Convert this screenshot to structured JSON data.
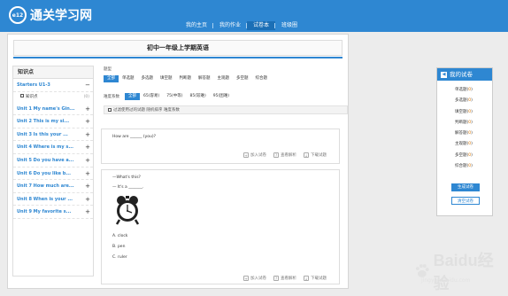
{
  "header": {
    "logo_badge": "e12",
    "logo_text": "通关学习网",
    "nav": [
      "我的主页",
      "我的作业",
      "试卷本",
      "班级圈"
    ],
    "active_nav": "试卷本",
    "brand_color": "#2e87d2"
  },
  "page_title": "初中一年级上学期英语",
  "sidebar": {
    "title": "知识点",
    "group": "Starters U1-3",
    "group_toggle": "−",
    "sub_item": "知识点",
    "sub_count": "(0)",
    "units": [
      "Unit 1 My name's Gin...",
      "Unit 2 This is my si...",
      "Unit 3 Is this your ...",
      "Unit 4 Where is my s...",
      "Unit 5 Do you have a...",
      "Unit 6 Do you like b...",
      "Unit 7 How much are...",
      "Unit 8 When is your ...",
      "Unit 9 My favorite s..."
    ],
    "unit_toggle": "+"
  },
  "filters": {
    "type_label": "题型",
    "types": [
      "全部",
      "单选题",
      "多选题",
      "填空题",
      "判断题",
      "解答题",
      "主观题",
      "多空题",
      "综合题"
    ],
    "active_type": "全部",
    "difficulty_label": "难度系数",
    "difficulties": [
      "全部",
      "65(容易)",
      "75(中等)",
      "85(较难)",
      "95(困难)"
    ],
    "active_difficulty": "全部",
    "options_text": "过滤使用过的试题  随机排序  难度系数"
  },
  "questions": [
    {
      "lines": [
        "How are ______ (you)?"
      ],
      "actions": [
        "加入试卷",
        "查看解析",
        "下载试题"
      ]
    },
    {
      "lines": [
        "—What's this?",
        "— It's a _______."
      ],
      "choices": [
        "A. clock",
        "B. pen",
        "C. ruler"
      ],
      "image": "alarm-clock",
      "actions": [
        "加入试卷",
        "查看解析",
        "下载试题"
      ]
    }
  ],
  "my_paper": {
    "title": "我的试卷",
    "rows": [
      {
        "label": "单选题",
        "count": "0"
      },
      {
        "label": "多选题",
        "count": "0"
      },
      {
        "label": "填空题",
        "count": "0"
      },
      {
        "label": "判断题",
        "count": "0"
      },
      {
        "label": "解答题",
        "count": "0"
      },
      {
        "label": "主观题",
        "count": "0"
      },
      {
        "label": "多空题",
        "count": "0"
      },
      {
        "label": "综合题",
        "count": "0"
      }
    ],
    "generate_label": "生成试卷",
    "clear_label": "清空试卷"
  },
  "watermark": {
    "text": "Baidu经验",
    "sub": "jingyan.baidu.com"
  }
}
